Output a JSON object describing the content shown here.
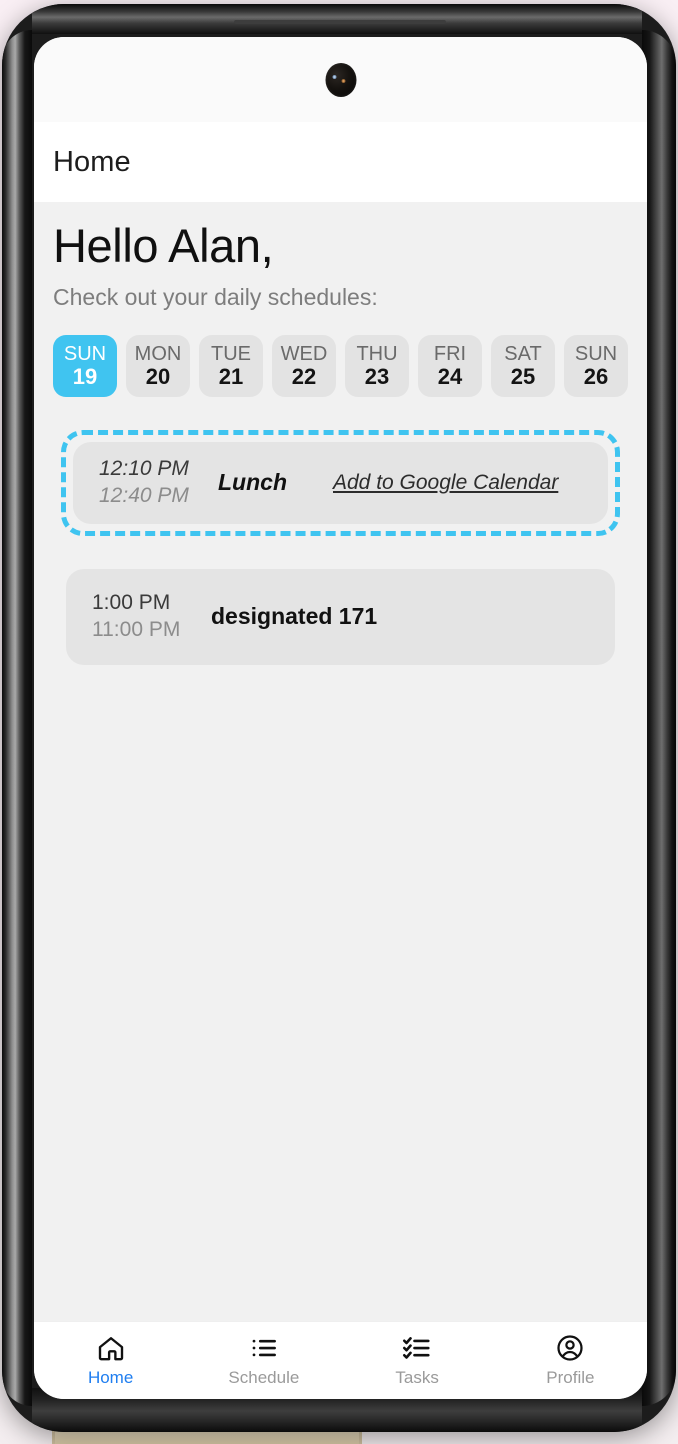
{
  "app_bar": {
    "title": "Home"
  },
  "greeting": {
    "heading": "Hello Alan,",
    "subtitle": "Check out your daily schedules:"
  },
  "date_strip": {
    "days": [
      {
        "name": "SUN",
        "num": "19",
        "selected": true
      },
      {
        "name": "MON",
        "num": "20",
        "selected": false
      },
      {
        "name": "TUE",
        "num": "21",
        "selected": false
      },
      {
        "name": "WED",
        "num": "22",
        "selected": false
      },
      {
        "name": "THU",
        "num": "23",
        "selected": false
      },
      {
        "name": "FRI",
        "num": "24",
        "selected": false
      },
      {
        "name": "SAT",
        "num": "25",
        "selected": false
      },
      {
        "name": "SUN",
        "num": "26",
        "selected": false
      }
    ]
  },
  "schedule": {
    "items": [
      {
        "start": "12:10 PM",
        "end": "12:40 PM",
        "title": "Lunch",
        "action": "Add to Google Calendar",
        "highlighted": true,
        "italic": true
      },
      {
        "start": "1:00 PM",
        "end": "11:00 PM",
        "title": "designated 171",
        "action": "",
        "highlighted": false,
        "italic": false
      }
    ]
  },
  "bottom_nav": {
    "items": [
      {
        "label": "Home",
        "icon": "home-icon",
        "active": true
      },
      {
        "label": "Schedule",
        "icon": "list-icon",
        "active": false
      },
      {
        "label": "Tasks",
        "icon": "checklist-icon",
        "active": false
      },
      {
        "label": "Profile",
        "icon": "person-circle-icon",
        "active": false
      }
    ]
  },
  "colors": {
    "accent_cyan": "#40c4f0",
    "nav_active_blue": "#1f7ef0",
    "page_bg": "#f1f1f1",
    "card_bg": "#e4e4e4",
    "chip_bg": "#e3e3e3"
  }
}
